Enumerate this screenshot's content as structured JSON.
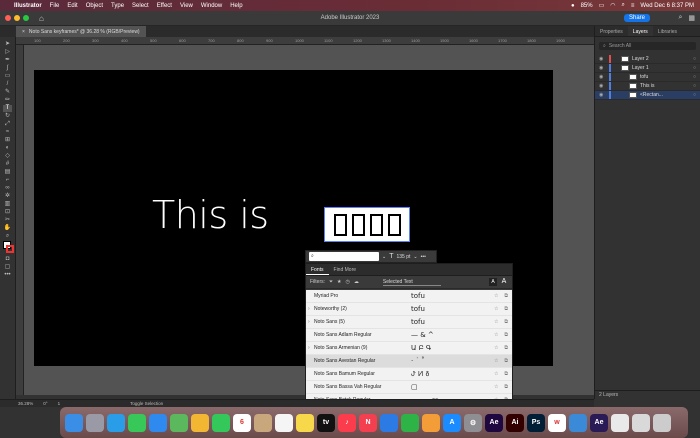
{
  "menubar": {
    "app_name": "Illustrator",
    "items": [
      "File",
      "Edit",
      "Object",
      "Type",
      "Select",
      "Effect",
      "View",
      "Window",
      "Help"
    ],
    "battery": "85%",
    "clock": "Wed Dec 6  8:37 PM"
  },
  "appbar": {
    "title": "Adobe Illustrator 2023",
    "share_label": "Share"
  },
  "document_tab": {
    "close": "×",
    "label": "Noto Sans keyframes* @ 36.28 % (RGB/Preview)"
  },
  "ruler_ticks": [
    "100",
    "200",
    "300",
    "400",
    "500",
    "600",
    "700",
    "800",
    "900",
    "1000",
    "1100",
    "1200",
    "1300",
    "1400",
    "1500",
    "1600",
    "1700",
    "1800",
    "1900"
  ],
  "artboard": {
    "text": "This is"
  },
  "char_panel": {
    "font_value": "",
    "font_placeholder": "",
    "size_value": "135 pt",
    "more": "•••"
  },
  "font_dropdown": {
    "tabs": [
      "Fonts",
      "Find More"
    ],
    "filters_label": "Filters:",
    "selected_text": "Selected Text",
    "fonts": [
      {
        "name": "Myriad Pro",
        "sample": "tofu",
        "expand": ""
      },
      {
        "name": "Noteworthy (2)",
        "sample": "tofu",
        "expand": "›"
      },
      {
        "name": "Noto Sans (5)",
        "sample": "tofu",
        "expand": "›"
      },
      {
        "name": "Noto Sans Adlam Regular",
        "sample": "— & ^",
        "expand": ""
      },
      {
        "name": "Noto Sans Armenian (9)",
        "sample": "Ա Բ Գ",
        "expand": "›"
      },
      {
        "name": "Noto Sans Avestan Regular",
        "sample": "· ˙ ˚",
        "expand": ""
      },
      {
        "name": "Noto Sans Bamum Regular",
        "sample": "ꚠ ꚡ ꚢ",
        "expand": ""
      },
      {
        "name": "Noto Sans Bassa Vah Regular",
        "sample": "▢",
        "expand": ""
      },
      {
        "name": "Noto Sans Batak Regular",
        "sample": "ᯀ ᯁ ᯂ",
        "expand": ""
      }
    ]
  },
  "right_panel": {
    "tabs": [
      "Properties",
      "Layers",
      "Libraries"
    ],
    "search_placeholder": "Search All",
    "layers": [
      {
        "name": "Layer 2",
        "color": "#e04f4f",
        "indent": 0
      },
      {
        "name": "Layer 1",
        "color": "#4f7fe0",
        "indent": 0
      },
      {
        "name": "tofu",
        "color": "#4f7fe0",
        "indent": 1
      },
      {
        "name": "This is",
        "color": "#4f7fe0",
        "indent": 1
      },
      {
        "name": "<Rectan...",
        "color": "#4f7fe0",
        "indent": 1
      }
    ],
    "footer": "2 Layers"
  },
  "statusbar": {
    "zoom": "36.28%",
    "rotation": "0°",
    "page": "1",
    "tool": "Toggle Selection"
  },
  "dock": {
    "icons": [
      {
        "name": "finder",
        "label": "",
        "color": "#3a8ee6"
      },
      {
        "name": "launchpad",
        "label": "",
        "color": "#9a9aa6"
      },
      {
        "name": "safari",
        "label": "",
        "color": "#2a9de8"
      },
      {
        "name": "messages",
        "label": "",
        "color": "#38c759"
      },
      {
        "name": "mail",
        "label": "",
        "color": "#2f8af0"
      },
      {
        "name": "maps",
        "label": "",
        "color": "#5cb85c"
      },
      {
        "name": "photos",
        "label": "",
        "color": "#f2b632"
      },
      {
        "name": "facetime",
        "label": "",
        "color": "#34c759"
      },
      {
        "name": "calendar",
        "label": "6",
        "color": "#ffffff"
      },
      {
        "name": "contacts",
        "label": "",
        "color": "#c9a77c"
      },
      {
        "name": "reminders",
        "label": "",
        "color": "#f5f5f5"
      },
      {
        "name": "notes",
        "label": "",
        "color": "#f7d84a"
      },
      {
        "name": "tv",
        "label": "tv",
        "color": "#111111"
      },
      {
        "name": "music",
        "label": "♪",
        "color": "#fa3c4c"
      },
      {
        "name": "news",
        "label": "N",
        "color": "#f33f4f"
      },
      {
        "name": "keynote",
        "label": "",
        "color": "#2c7be5"
      },
      {
        "name": "numbers",
        "label": "",
        "color": "#2eb347"
      },
      {
        "name": "pages",
        "label": "",
        "color": "#f29d38"
      },
      {
        "name": "appstore",
        "label": "A",
        "color": "#1a8cff"
      },
      {
        "name": "settings",
        "label": "⚙",
        "color": "#8e8e93"
      },
      {
        "name": "after-effects",
        "label": "Ae",
        "color": "#1f0740"
      },
      {
        "name": "illustrator",
        "label": "Ai",
        "color": "#330000"
      },
      {
        "name": "photoshop",
        "label": "Ps",
        "color": "#001e36"
      },
      {
        "name": "webex",
        "label": "w",
        "color": "#ffffff"
      },
      {
        "name": "downloads",
        "label": "",
        "color": "#3b8ad8"
      },
      {
        "name": "ae-file",
        "label": "Ae",
        "color": "#2a1a55"
      },
      {
        "name": "screenshot",
        "label": "",
        "color": "#e9e9e9"
      },
      {
        "name": "screenshot-2",
        "label": "",
        "color": "#d9d9d9"
      },
      {
        "name": "trash",
        "label": "",
        "color": "#cccccc"
      }
    ]
  },
  "colors": {
    "accent": "#1473e6",
    "artboard": "#000000",
    "selection": "#5a82ff"
  }
}
